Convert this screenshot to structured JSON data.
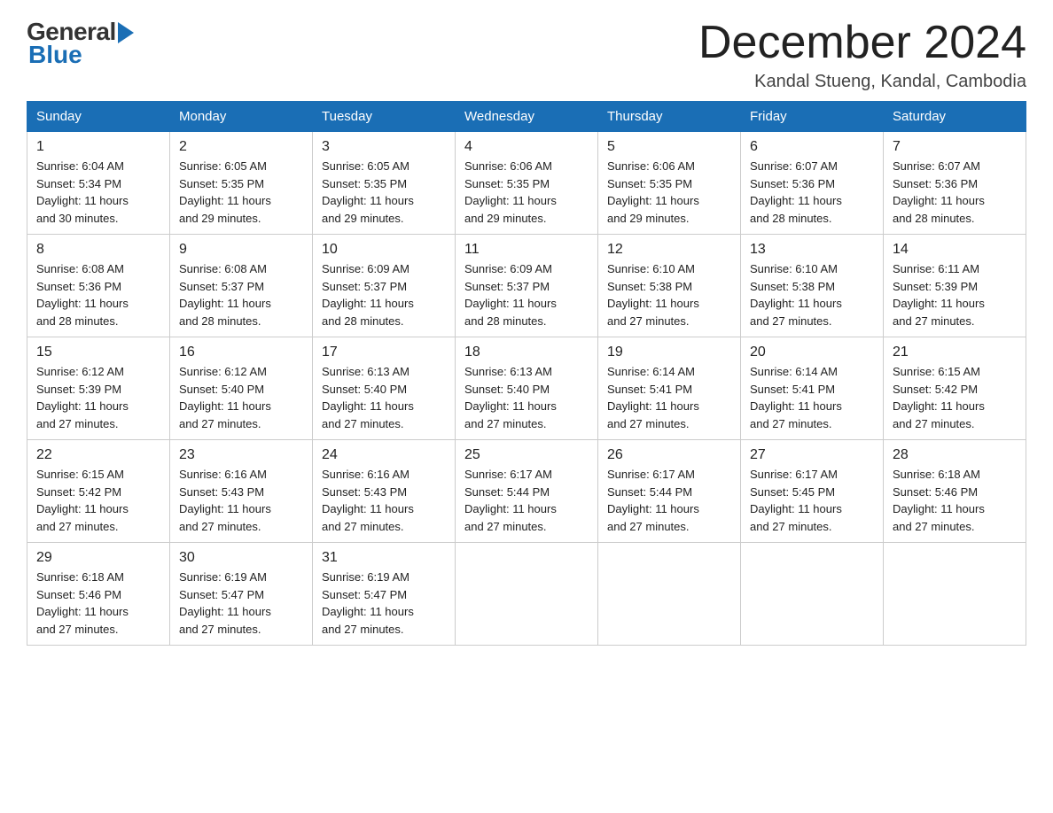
{
  "header": {
    "logo_general": "General",
    "logo_blue": "Blue",
    "month_title": "December 2024",
    "location": "Kandal Stueng, Kandal, Cambodia"
  },
  "days_of_week": [
    "Sunday",
    "Monday",
    "Tuesday",
    "Wednesday",
    "Thursday",
    "Friday",
    "Saturday"
  ],
  "weeks": [
    [
      {
        "day": "1",
        "sunrise": "6:04 AM",
        "sunset": "5:34 PM",
        "daylight": "11 hours and 30 minutes."
      },
      {
        "day": "2",
        "sunrise": "6:05 AM",
        "sunset": "5:35 PM",
        "daylight": "11 hours and 29 minutes."
      },
      {
        "day": "3",
        "sunrise": "6:05 AM",
        "sunset": "5:35 PM",
        "daylight": "11 hours and 29 minutes."
      },
      {
        "day": "4",
        "sunrise": "6:06 AM",
        "sunset": "5:35 PM",
        "daylight": "11 hours and 29 minutes."
      },
      {
        "day": "5",
        "sunrise": "6:06 AM",
        "sunset": "5:35 PM",
        "daylight": "11 hours and 29 minutes."
      },
      {
        "day": "6",
        "sunrise": "6:07 AM",
        "sunset": "5:36 PM",
        "daylight": "11 hours and 28 minutes."
      },
      {
        "day": "7",
        "sunrise": "6:07 AM",
        "sunset": "5:36 PM",
        "daylight": "11 hours and 28 minutes."
      }
    ],
    [
      {
        "day": "8",
        "sunrise": "6:08 AM",
        "sunset": "5:36 PM",
        "daylight": "11 hours and 28 minutes."
      },
      {
        "day": "9",
        "sunrise": "6:08 AM",
        "sunset": "5:37 PM",
        "daylight": "11 hours and 28 minutes."
      },
      {
        "day": "10",
        "sunrise": "6:09 AM",
        "sunset": "5:37 PM",
        "daylight": "11 hours and 28 minutes."
      },
      {
        "day": "11",
        "sunrise": "6:09 AM",
        "sunset": "5:37 PM",
        "daylight": "11 hours and 28 minutes."
      },
      {
        "day": "12",
        "sunrise": "6:10 AM",
        "sunset": "5:38 PM",
        "daylight": "11 hours and 27 minutes."
      },
      {
        "day": "13",
        "sunrise": "6:10 AM",
        "sunset": "5:38 PM",
        "daylight": "11 hours and 27 minutes."
      },
      {
        "day": "14",
        "sunrise": "6:11 AM",
        "sunset": "5:39 PM",
        "daylight": "11 hours and 27 minutes."
      }
    ],
    [
      {
        "day": "15",
        "sunrise": "6:12 AM",
        "sunset": "5:39 PM",
        "daylight": "11 hours and 27 minutes."
      },
      {
        "day": "16",
        "sunrise": "6:12 AM",
        "sunset": "5:40 PM",
        "daylight": "11 hours and 27 minutes."
      },
      {
        "day": "17",
        "sunrise": "6:13 AM",
        "sunset": "5:40 PM",
        "daylight": "11 hours and 27 minutes."
      },
      {
        "day": "18",
        "sunrise": "6:13 AM",
        "sunset": "5:40 PM",
        "daylight": "11 hours and 27 minutes."
      },
      {
        "day": "19",
        "sunrise": "6:14 AM",
        "sunset": "5:41 PM",
        "daylight": "11 hours and 27 minutes."
      },
      {
        "day": "20",
        "sunrise": "6:14 AM",
        "sunset": "5:41 PM",
        "daylight": "11 hours and 27 minutes."
      },
      {
        "day": "21",
        "sunrise": "6:15 AM",
        "sunset": "5:42 PM",
        "daylight": "11 hours and 27 minutes."
      }
    ],
    [
      {
        "day": "22",
        "sunrise": "6:15 AM",
        "sunset": "5:42 PM",
        "daylight": "11 hours and 27 minutes."
      },
      {
        "day": "23",
        "sunrise": "6:16 AM",
        "sunset": "5:43 PM",
        "daylight": "11 hours and 27 minutes."
      },
      {
        "day": "24",
        "sunrise": "6:16 AM",
        "sunset": "5:43 PM",
        "daylight": "11 hours and 27 minutes."
      },
      {
        "day": "25",
        "sunrise": "6:17 AM",
        "sunset": "5:44 PM",
        "daylight": "11 hours and 27 minutes."
      },
      {
        "day": "26",
        "sunrise": "6:17 AM",
        "sunset": "5:44 PM",
        "daylight": "11 hours and 27 minutes."
      },
      {
        "day": "27",
        "sunrise": "6:17 AM",
        "sunset": "5:45 PM",
        "daylight": "11 hours and 27 minutes."
      },
      {
        "day": "28",
        "sunrise": "6:18 AM",
        "sunset": "5:46 PM",
        "daylight": "11 hours and 27 minutes."
      }
    ],
    [
      {
        "day": "29",
        "sunrise": "6:18 AM",
        "sunset": "5:46 PM",
        "daylight": "11 hours and 27 minutes."
      },
      {
        "day": "30",
        "sunrise": "6:19 AM",
        "sunset": "5:47 PM",
        "daylight": "11 hours and 27 minutes."
      },
      {
        "day": "31",
        "sunrise": "6:19 AM",
        "sunset": "5:47 PM",
        "daylight": "11 hours and 27 minutes."
      },
      null,
      null,
      null,
      null
    ]
  ],
  "labels": {
    "sunrise": "Sunrise:",
    "sunset": "Sunset:",
    "daylight": "Daylight:"
  }
}
